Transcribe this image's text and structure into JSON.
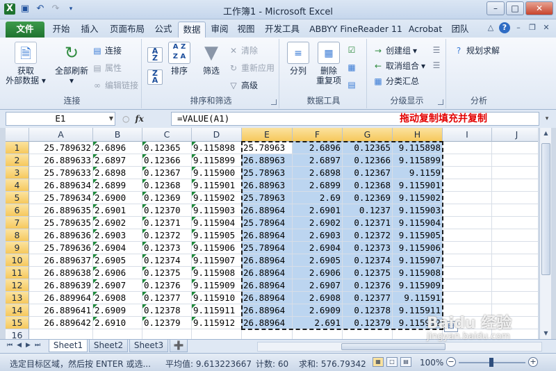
{
  "window": {
    "title": "工作簿1 - Microsoft Excel"
  },
  "quick_access": {
    "icons": [
      "excel-logo-icon",
      "save-icon",
      "undo-icon",
      "redo-icon",
      "customize-qat-icon"
    ]
  },
  "ribbon_tabs": [
    "文件",
    "开始",
    "插入",
    "页面布局",
    "公式",
    "数据",
    "审阅",
    "视图",
    "开发工具",
    "ABBYY FineReader 11",
    "Acrobat",
    "团队"
  ],
  "active_tab": "数据",
  "groups": {
    "connections": {
      "label": "连接",
      "get_external": "获取\n外部数据",
      "refresh_all": "全部刷新",
      "connections": "连接",
      "properties": "属性",
      "edit_links": "编辑链接"
    },
    "sort_filter": {
      "label": "排序和筛选",
      "sort": "排序",
      "filter": "筛选",
      "clear": "清除",
      "reapply": "重新应用",
      "advanced": "高级"
    },
    "data_tools": {
      "label": "数据工具",
      "text_to_columns": "分列",
      "remove_duplicates": "删除\n重复项"
    },
    "outline": {
      "label": "分级显示",
      "group": "创建组",
      "ungroup": "取消组合",
      "subtotal": "分类汇总"
    },
    "analysis": {
      "label": "分析",
      "solver": "规划求解"
    }
  },
  "formula_bar": {
    "name_box": "E1",
    "fx": "fx",
    "formula": "=VALUE(A1)",
    "annotation": "拖动复制填充并复制"
  },
  "sheet": {
    "columns": [
      "A",
      "B",
      "C",
      "D",
      "E",
      "F",
      "G",
      "H",
      "I",
      "J"
    ],
    "rows": [
      "1",
      "2",
      "3",
      "4",
      "5",
      "6",
      "7",
      "8",
      "9",
      "10",
      "11",
      "12",
      "13",
      "14",
      "15",
      "16"
    ],
    "A": [
      "25.789632",
      "26.889633",
      "25.789633",
      "26.889634",
      "25.789634",
      "26.889635",
      "25.789635",
      "26.889636",
      "25.789636",
      "26.889637",
      "26.889638",
      "26.889639",
      "26.889964",
      "26.889641",
      "26.889642"
    ],
    "B": [
      "2.6896",
      "2.6897",
      "2.6898",
      "2.6899",
      "2.6900",
      "2.6901",
      "2.6902",
      "2.6903",
      "2.6904",
      "2.6905",
      "2.6906",
      "2.6907",
      "2.6908",
      "2.6909",
      "2.6910"
    ],
    "C": [
      "0.12365",
      "0.12366",
      "0.12367",
      "0.12368",
      "0.12369",
      "0.12370",
      "0.12371",
      "0.12372",
      "0.12373",
      "0.12374",
      "0.12375",
      "0.12376",
      "0.12377",
      "0.12378",
      "0.12379"
    ],
    "D": [
      "9.115898",
      "9.115899",
      "9.115900",
      "9.115901",
      "9.115902",
      "9.115903",
      "9.115904",
      "9.115905",
      "9.115906",
      "9.115907",
      "9.115908",
      "9.115909",
      "9.115910",
      "9.115911",
      "9.115912"
    ],
    "E": [
      "25.78963",
      "26.88963",
      "25.78963",
      "26.88963",
      "25.78963",
      "26.88964",
      "25.78964",
      "26.88964",
      "25.78964",
      "26.88964",
      "26.88964",
      "26.88964",
      "26.88964",
      "26.88964",
      "26.88964"
    ],
    "F": [
      "2.6896",
      "2.6897",
      "2.6898",
      "2.6899",
      "2.69",
      "2.6901",
      "2.6902",
      "2.6903",
      "2.6904",
      "2.6905",
      "2.6906",
      "2.6907",
      "2.6908",
      "2.6909",
      "2.691"
    ],
    "G": [
      "0.12365",
      "0.12366",
      "0.12367",
      "0.12368",
      "0.12369",
      "0.1237",
      "0.12371",
      "0.12372",
      "0.12373",
      "0.12374",
      "0.12375",
      "0.12376",
      "0.12377",
      "0.12378",
      "0.12379"
    ],
    "H": [
      "9.115898",
      "9.115899",
      "9.1159",
      "9.115901",
      "9.115902",
      "9.115903",
      "9.115904",
      "9.115905",
      "9.115906",
      "9.115907",
      "9.115908",
      "9.115909",
      "9.11591",
      "9.115911",
      "9.115912"
    ]
  },
  "sheet_tabs": [
    "Sheet1",
    "Sheet2",
    "Sheet3"
  ],
  "active_sheet": "Sheet1",
  "status": {
    "message": "选定目标区域，然后按 ENTER 或选...",
    "average": "平均值: 9.613223667",
    "count": "计数: 60",
    "sum": "求和: 576.79342",
    "zoom": "100%"
  },
  "watermark": {
    "text": "Baidu 经验",
    "sub": "jingyan.baidu.com"
  },
  "colors": {
    "file_tab": "#1f7330",
    "selection": "#bcd5f0",
    "header_selected": "#f6c85c",
    "annotation": "#e30000"
  }
}
